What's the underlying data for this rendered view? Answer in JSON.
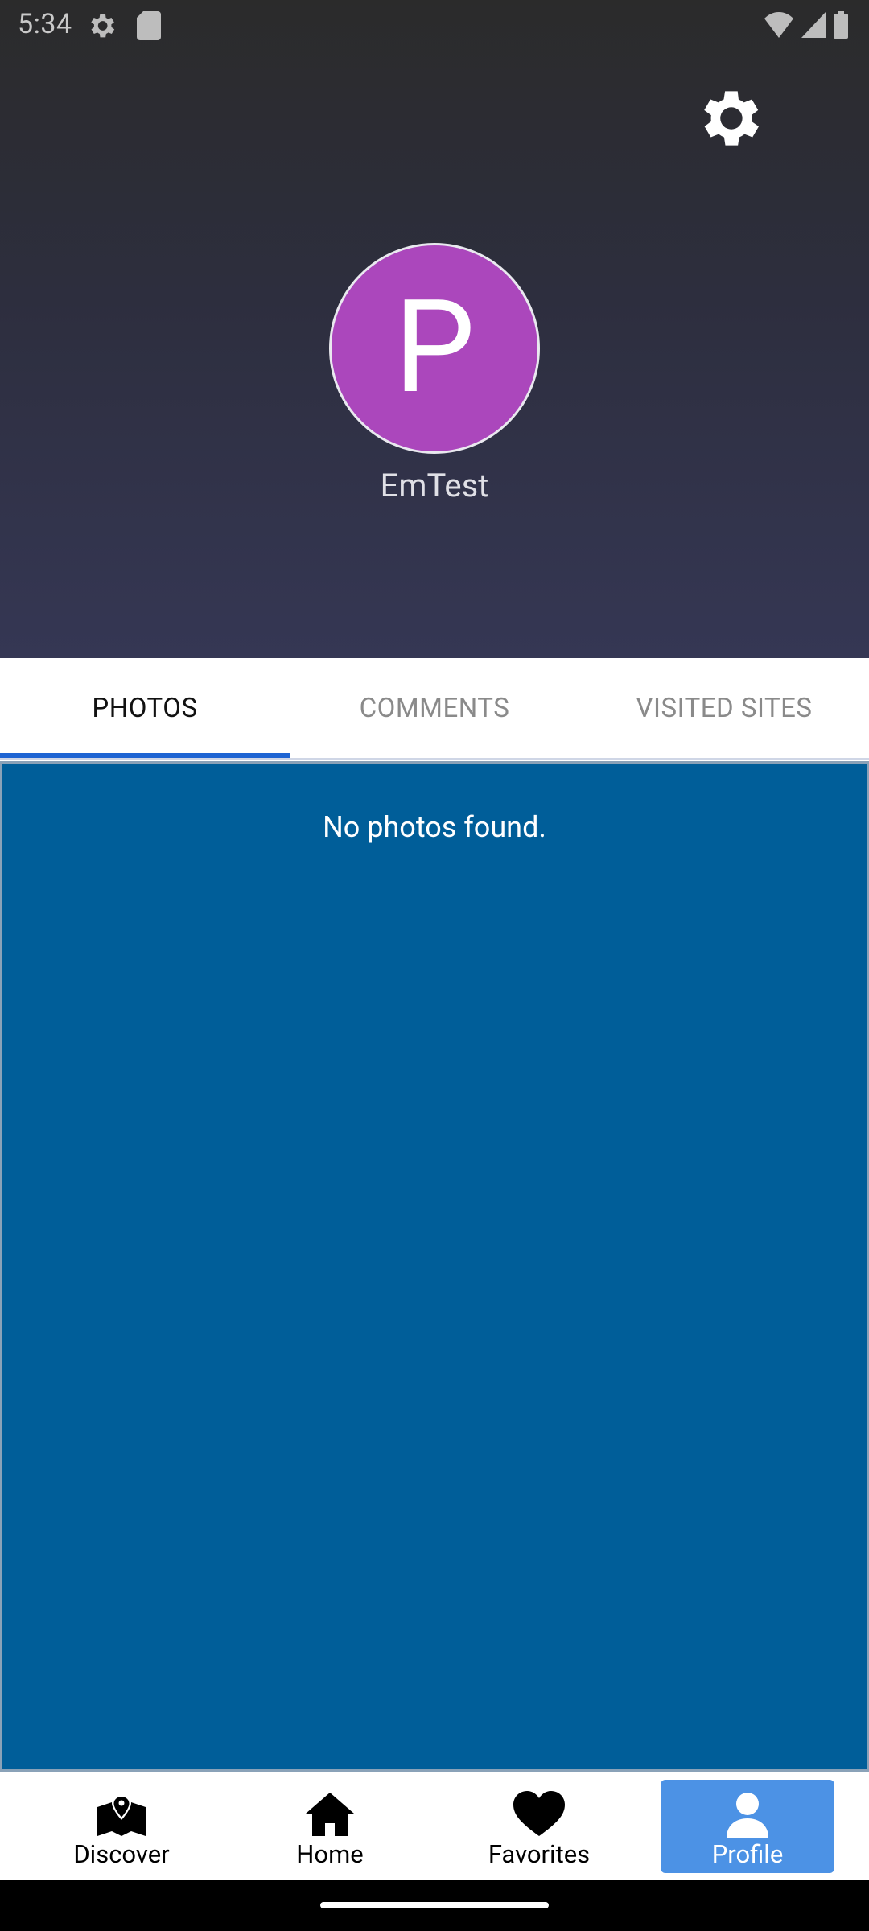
{
  "status_bar": {
    "time": "5:34",
    "icons": [
      "settings-gear-icon",
      "sd-card-icon",
      "wifi-icon",
      "cellular-signal-icon",
      "battery-icon"
    ]
  },
  "header": {
    "settings_icon": "gear-icon",
    "avatar_initial": "P",
    "avatar_color": "#ab47bc",
    "username": "EmTest"
  },
  "tabs": [
    {
      "label": "PHOTOS",
      "active": true
    },
    {
      "label": "COMMENTS",
      "active": false
    },
    {
      "label": "VISITED SITES",
      "active": false
    }
  ],
  "content": {
    "empty_message": "No photos found.",
    "background_color": "#005e99"
  },
  "bottom_nav": [
    {
      "label": "Discover",
      "icon": "map-pin-icon",
      "active": false
    },
    {
      "label": "Home",
      "icon": "home-icon",
      "active": false
    },
    {
      "label": "Favorites",
      "icon": "heart-icon",
      "active": false
    },
    {
      "label": "Profile",
      "icon": "person-icon",
      "active": true
    }
  ],
  "colors": {
    "accent": "#1e64d3",
    "active_nav": "#4c92e5"
  }
}
